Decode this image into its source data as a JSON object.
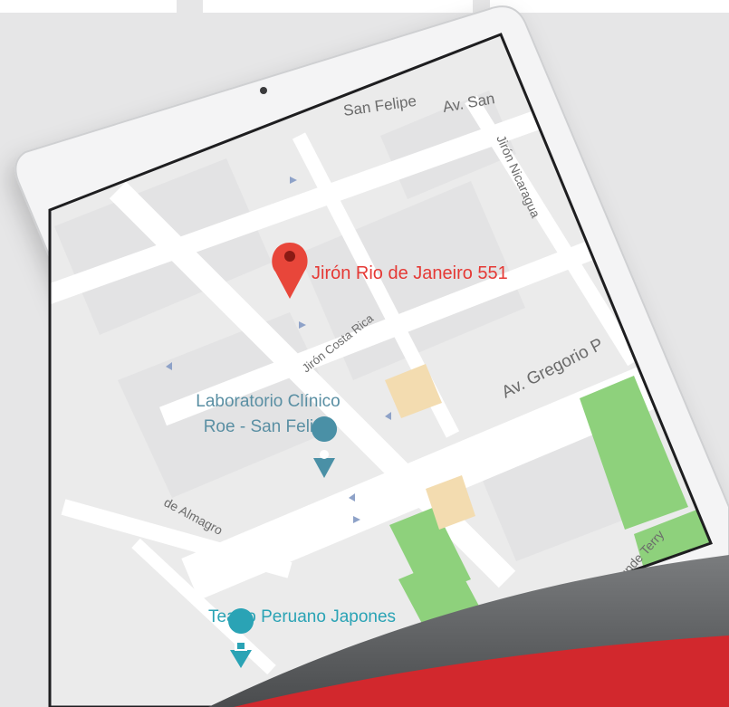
{
  "map": {
    "pin_label": "Jirón Rio de Janeiro 551",
    "lab_name_line1": "Laboratorio Clínico",
    "lab_name_line2": "Roe - San Felipe",
    "theatre_name": "Teatro Peruano Japones",
    "streets": {
      "san_felipe": "San Felipe",
      "av_san": "Av. San",
      "nicaragua": "Jirón Nicaragua",
      "costa_rica": "Jirón Costa Rica",
      "gregorio": "Av. Gregorio P",
      "almagro": "de Almagro",
      "terry": "unde Terry"
    }
  },
  "colors": {
    "pin_red": "#e8463a",
    "poi_blue": "#4a90a6",
    "theatre_teal": "#2aa3b5",
    "park_green": "#8ed17c",
    "accent_red": "#d2282d",
    "accent_gray": "#5c5e60"
  }
}
